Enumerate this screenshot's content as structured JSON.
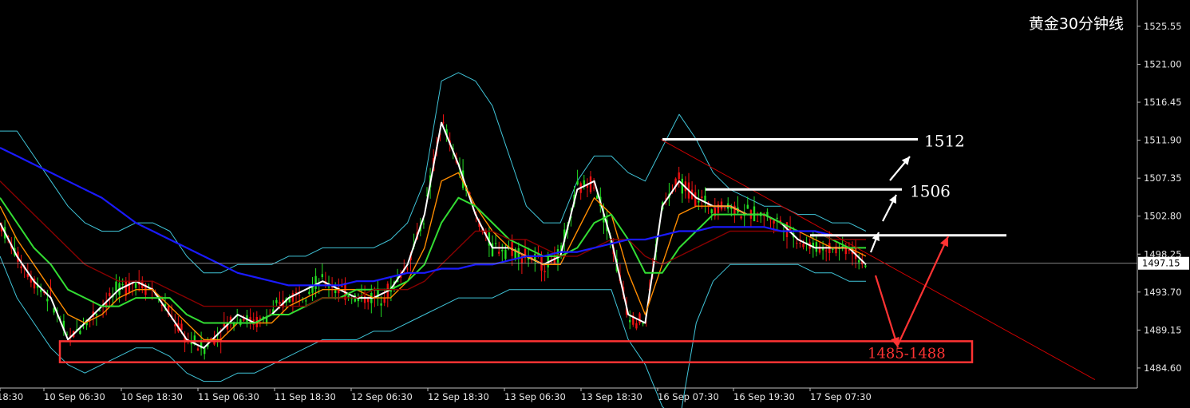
{
  "chart_data": {
    "type": "candlestick",
    "title": "黄金30分钟线",
    "y_axis": {
      "ylim": [
        1482.2,
        1528.7
      ],
      "ticks": [
        "1525.55",
        "1521.00",
        "1516.45",
        "1511.90",
        "1507.35",
        "1502.80",
        "1498.25",
        "1493.70",
        "1489.15",
        "1484.60"
      ]
    },
    "x_axis": {
      "ticks": [
        "18:30",
        "10 Sep 06:30",
        "10 Sep 18:30",
        "11 Sep 06:30",
        "11 Sep 18:30",
        "12 Sep 06:30",
        "12 Sep 18:30",
        "13 Sep 06:30",
        "13 Sep 18:30",
        "16 Sep 07:30",
        "16 Sep 19:30",
        "17 Sep 07:30"
      ]
    },
    "current_price": {
      "value": 1497.15,
      "label": "1497.15"
    },
    "resistance_levels": [
      {
        "value": 1512,
        "label": "1512"
      },
      {
        "value": 1506,
        "label": "1506"
      },
      {
        "value": 1500.5,
        "label": ""
      }
    ],
    "support_zone": {
      "low": 1485,
      "high": 1488,
      "label": "1485-1488"
    },
    "series": [
      {
        "name": "",
        "color": "#ffffff",
        "values": [
          1502,
          1498,
          1495,
          1493,
          1488,
          1490,
          1492,
          1494,
          1495,
          1494,
          1491,
          1488,
          1487,
          1489,
          1491,
          1490,
          1491,
          1493,
          1494,
          1495,
          1494,
          1493,
          1493,
          1494,
          1497,
          1503,
          1514,
          1509,
          1503,
          1499,
          1499,
          1498,
          1497,
          1498,
          1506,
          1507,
          1500,
          1491,
          1490,
          1504,
          1507,
          1505,
          1504,
          1504,
          1503,
          1503,
          1502,
          1500,
          1499,
          1499,
          1499,
          1497
        ]
      },
      {
        "name": "",
        "color": "#ff8c00",
        "values": [
          1504,
          1500,
          1497,
          1494,
          1491,
          1490,
          1491,
          1493,
          1494,
          1494,
          1492,
          1490,
          1488,
          1488,
          1490,
          1490,
          1490,
          1492,
          1493,
          1494,
          1494,
          1494,
          1493,
          1493,
          1495,
          1499,
          1507,
          1508,
          1504,
          1501,
          1499,
          1498,
          1497,
          1497,
          1501,
          1505,
          1503,
          1496,
          1491,
          1497,
          1503,
          1504,
          1504,
          1504,
          1503,
          1503,
          1502,
          1501,
          1500,
          1499,
          1499,
          1498
        ]
      },
      {
        "name": "",
        "color": "#33dd33",
        "values": [
          1505,
          1502,
          1499,
          1497,
          1494,
          1493,
          1492,
          1492,
          1493,
          1493,
          1493,
          1491,
          1490,
          1490,
          1490,
          1490,
          1491,
          1491,
          1492,
          1493,
          1493,
          1494,
          1494,
          1494,
          1495,
          1497,
          1502,
          1505,
          1504,
          1502,
          1500,
          1499,
          1498,
          1498,
          1499,
          1502,
          1503,
          1500,
          1496,
          1496,
          1499,
          1501,
          1503,
          1503,
          1503,
          1503,
          1502,
          1501,
          1501,
          1500,
          1499,
          1499
        ]
      },
      {
        "name": "",
        "color": "#880000",
        "values": [
          1507,
          1505,
          1503,
          1501,
          1499,
          1497,
          1496,
          1495,
          1495,
          1495,
          1494,
          1493,
          1492,
          1492,
          1492,
          1492,
          1492,
          1492,
          1492,
          1493,
          1493,
          1493,
          1494,
          1494,
          1494,
          1495,
          1497,
          1499,
          1501,
          1501,
          1500,
          1500,
          1499,
          1498,
          1498,
          1499,
          1500,
          1500,
          1498,
          1497,
          1498,
          1499,
          1500,
          1501,
          1501,
          1501,
          1501,
          1501,
          1501,
          1500,
          1500,
          1500
        ]
      },
      {
        "name": "",
        "color": "#1a1aff",
        "values": [
          1511,
          1510,
          1509,
          1508,
          1507,
          1506,
          1505,
          1503.5,
          1502,
          1501,
          1500,
          1499,
          1498,
          1497,
          1496,
          1495.5,
          1495,
          1494.5,
          1494.5,
          1494.5,
          1494.5,
          1495,
          1495,
          1495.5,
          1496,
          1496,
          1496.5,
          1496.5,
          1497,
          1497,
          1497.5,
          1498,
          1498,
          1498.5,
          1498.5,
          1499,
          1499.5,
          1500,
          1500,
          1500.5,
          1501,
          1501,
          1501.5,
          1501.5,
          1501.5,
          1501.5,
          1501,
          1501,
          1501,
          1500.5,
          1500.5,
          1500.5
        ]
      },
      {
        "name": "",
        "color": "#40c4d8",
        "values": [
          1513,
          1513,
          1510,
          1507,
          1504,
          1502,
          1501,
          1501,
          1502,
          1502,
          1501,
          1498,
          1496,
          1496,
          1497,
          1497,
          1497,
          1498,
          1498,
          1499,
          1499,
          1499,
          1499,
          1500,
          1502,
          1507,
          1519,
          1520,
          1519,
          1516,
          1510,
          1504,
          1502,
          1502,
          1507,
          1510,
          1510,
          1508,
          1507,
          1511,
          1515,
          1512,
          1508,
          1506,
          1505,
          1504,
          1504,
          1503,
          1503,
          1502,
          1502,
          1501
        ]
      },
      {
        "name": "",
        "color": "#40c4d8",
        "values": [
          1498,
          1493,
          1490,
          1487,
          1485,
          1484,
          1485,
          1486,
          1487,
          1487,
          1486,
          1484,
          1483,
          1483,
          1484,
          1484,
          1485,
          1486,
          1487,
          1488,
          1488,
          1488,
          1489,
          1489,
          1490,
          1491,
          1492,
          1493,
          1493,
          1493,
          1494,
          1494,
          1494,
          1494,
          1494,
          1494,
          1494,
          1488,
          1485,
          1480,
          1478,
          1490,
          1495,
          1497,
          1497,
          1497,
          1497,
          1497,
          1496,
          1496,
          1495,
          1495
        ]
      }
    ],
    "grid": false,
    "legend": "none"
  }
}
